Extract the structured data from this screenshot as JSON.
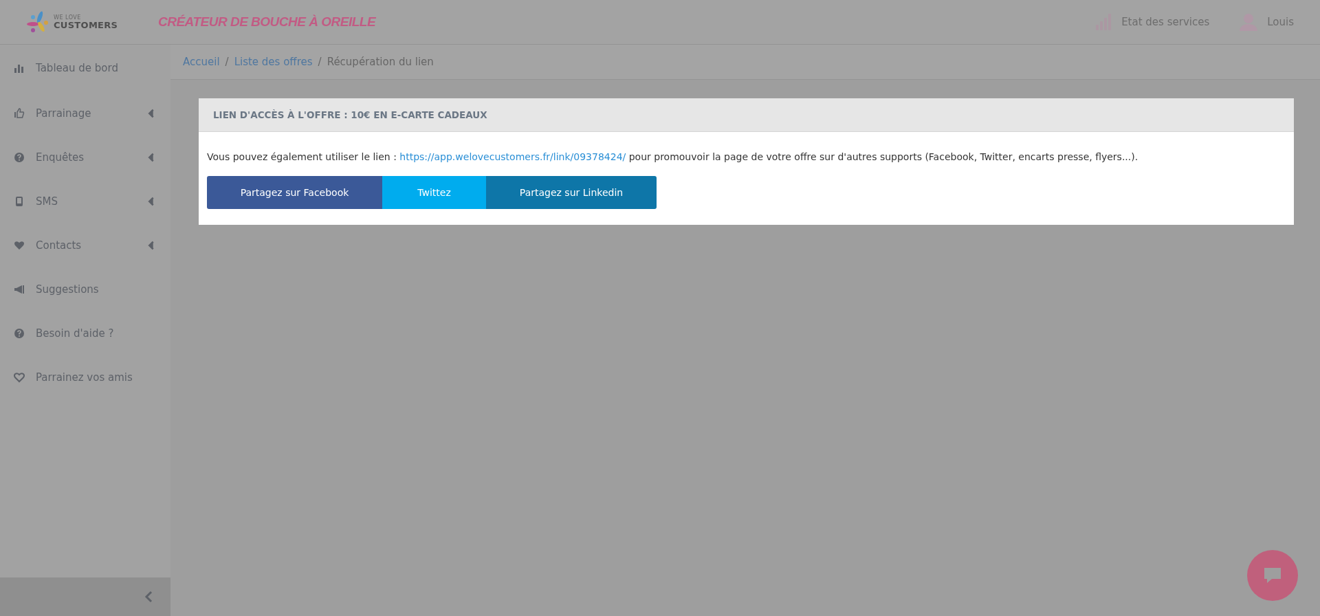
{
  "header": {
    "logo": {
      "top": "WE LOVE",
      "bottom": "CUSTOMERS"
    },
    "tagline": "CRÉATEUR DE BOUCHE À OREILLE",
    "status_link": "Etat des services",
    "user": "Louis"
  },
  "sidebar": {
    "items": [
      {
        "label": "Tableau de bord",
        "has_submenu": false
      },
      {
        "label": "Parrainage",
        "has_submenu": true
      },
      {
        "label": "Enquêtes",
        "has_submenu": true
      },
      {
        "label": "SMS",
        "has_submenu": true
      },
      {
        "label": "Contacts",
        "has_submenu": true
      },
      {
        "label": "Suggestions",
        "has_submenu": false
      },
      {
        "label": "Besoin d'aide ?",
        "has_submenu": false
      },
      {
        "label": "Parrainez vos amis",
        "has_submenu": false
      }
    ]
  },
  "breadcrumb": [
    {
      "label": "Accueil",
      "kind": "link"
    },
    {
      "label": "/",
      "kind": "separator"
    },
    {
      "label": "Liste des offres",
      "kind": "link"
    },
    {
      "label": "/",
      "kind": "separator"
    },
    {
      "label": "Récupération du lien",
      "kind": "current"
    }
  ],
  "card": {
    "title": "LIEN D'ACCÈS À L'OFFRE : 10€ EN E-CARTE CADEAUX",
    "text_before": "Vous pouvez également utiliser le lien :",
    "link": "https://app.welovecustomers.fr/link/09378424/",
    "text_after": "pour promouvoir la page de votre offre sur d'autres supports (Facebook, Twitter, encarts presse, flyers...).",
    "buttons": [
      {
        "label": "Partagez sur Facebook",
        "kind": "facebook"
      },
      {
        "label": "Twittez",
        "kind": "twitter"
      },
      {
        "label": "Partagez sur Linkedin",
        "kind": "linkedin"
      }
    ]
  }
}
